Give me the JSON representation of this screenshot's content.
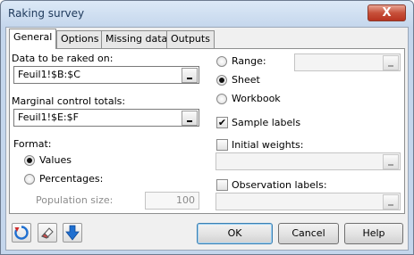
{
  "window": {
    "title": "Raking survey",
    "close_symbol": "X"
  },
  "tabs": [
    {
      "label": "General",
      "active": true
    },
    {
      "label": "Options",
      "active": false
    },
    {
      "label": "Missing data",
      "active": false
    },
    {
      "label": "Outputs",
      "active": false
    }
  ],
  "general": {
    "data_label": "Data to be raked on:",
    "data_value": "Feuil1!$B:$C",
    "marginal_label": "Marginal control totals:",
    "marginal_value": "Feuil1!$E:$F",
    "format_label": "Format:",
    "format_options": [
      {
        "label": "Values",
        "selected": true
      },
      {
        "label": "Percentages:",
        "selected": false
      }
    ],
    "population_size_label": "Population size:",
    "population_size_value": "100",
    "range_options": [
      {
        "label": "Range:",
        "selected": false
      },
      {
        "label": "Sheet",
        "selected": true
      },
      {
        "label": "Workbook",
        "selected": false
      }
    ],
    "range_value": "",
    "sample_labels": {
      "label": "Sample labels",
      "checked": true
    },
    "initial_weights": {
      "label": "Initial weights:",
      "checked": false,
      "value": ""
    },
    "observation_labels": {
      "label": "Observation labels:",
      "checked": false,
      "value": ""
    }
  },
  "buttons": {
    "ok": "OK",
    "cancel": "Cancel",
    "help": "Help"
  },
  "icons": [
    "reset-icon",
    "eraser-icon",
    "down-arrow-icon"
  ],
  "colors": {
    "title_text": "#1e395b",
    "close_button": "#c7503a",
    "icon_blue": "#1f6fd0"
  }
}
